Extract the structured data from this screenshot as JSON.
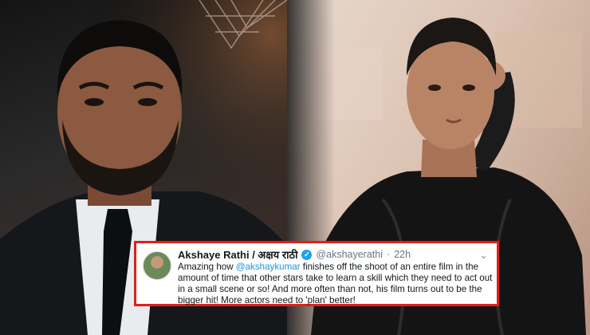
{
  "tweet": {
    "name": "Akshaye Rathi / अक्षय राठी",
    "handle": "@akshayerathi",
    "separator": "·",
    "time": "22h",
    "more": "⌄",
    "text_before": "Amazing how ",
    "mention": "@akshaykumar",
    "text_after": " finishes off the shoot of an entire film in the amount of time that other stars take to learn a skill which they need to act out in a small scene or so! And more often than not, his film turns out to be the bigger hit! More actors need to 'plan' better!"
  },
  "colors": {
    "border": "#e0201b",
    "mention": "#1b95e0",
    "verified": "#1da1f2"
  }
}
